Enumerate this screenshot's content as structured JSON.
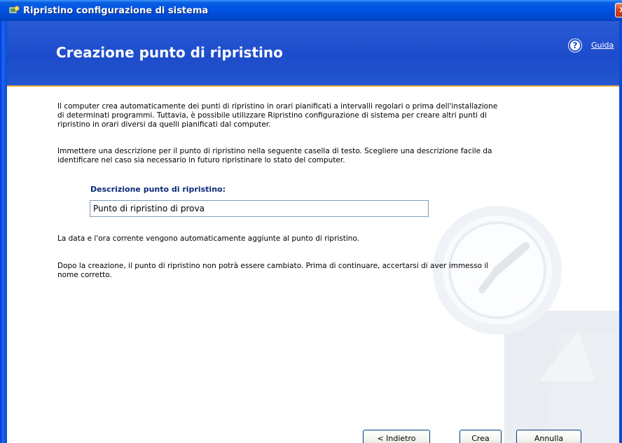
{
  "window": {
    "title": "Ripristino configurazione di sistema",
    "close_glyph": "×"
  },
  "header": {
    "title": "Creazione punto di ripristino",
    "help_icon": "help-icon",
    "help_glyph": "?",
    "help_link": "Guida"
  },
  "body": {
    "paragraph1": "Il computer crea automaticamente dei punti di ripristino in orari pianificati a intervalli regolari o prima dell'installazione di determinati programmi. Tuttavia, è possibile utilizzare Ripristino configurazione di sistema per creare altri punti di ripristino in orari diversi da quelli pianificati dal computer.",
    "paragraph2": "Immettere una descrizione per il punto di ripristino nella seguente casella di testo. Scegliere una descrizione facile da identificare nel caso sia necessario in futuro ripristinare lo stato del computer.",
    "field_label": "Descrizione punto di ripristino:",
    "field_value": "Punto di ripristino di prova",
    "paragraph3": "La data e l'ora corrente vengono automaticamente aggiunte al punto di ripristino.",
    "paragraph4": "Dopo la creazione, il punto di ripristino non potrà essere cambiato. Prima di continuare, accertarsi di aver immesso il nome corretto."
  },
  "buttons": {
    "back": "< Indietro",
    "create": "Crea",
    "cancel": "Annulla"
  },
  "colors": {
    "titlebar": "#0054e3",
    "header": "#1d4ccb",
    "accent_line": "#f2b441",
    "label_blue": "#0b2a7a"
  }
}
